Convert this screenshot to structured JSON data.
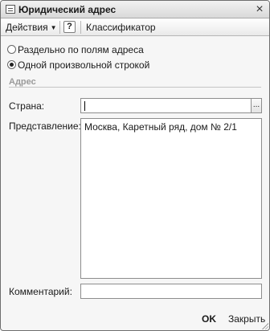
{
  "window": {
    "title": "Юридический адрес",
    "close_glyph": "×"
  },
  "toolbar": {
    "actions_label": "Действия",
    "help_label": "?",
    "classifier_label": "Классификатор"
  },
  "mode": {
    "options": [
      {
        "label": "Раздельно по полям адреса",
        "selected": false
      },
      {
        "label": "Одной произвольной строкой",
        "selected": true
      }
    ]
  },
  "address_group": {
    "title": "Адрес",
    "country_label": "Страна:",
    "country_value": "",
    "country_select_glyph": "...",
    "representation_label": "Представление:",
    "representation_value": "Москва, Каретный ряд, дом № 2/1",
    "comment_label": "Комментарий:",
    "comment_value": ""
  },
  "footer": {
    "ok_label": "OK",
    "close_label": "Закрыть"
  }
}
